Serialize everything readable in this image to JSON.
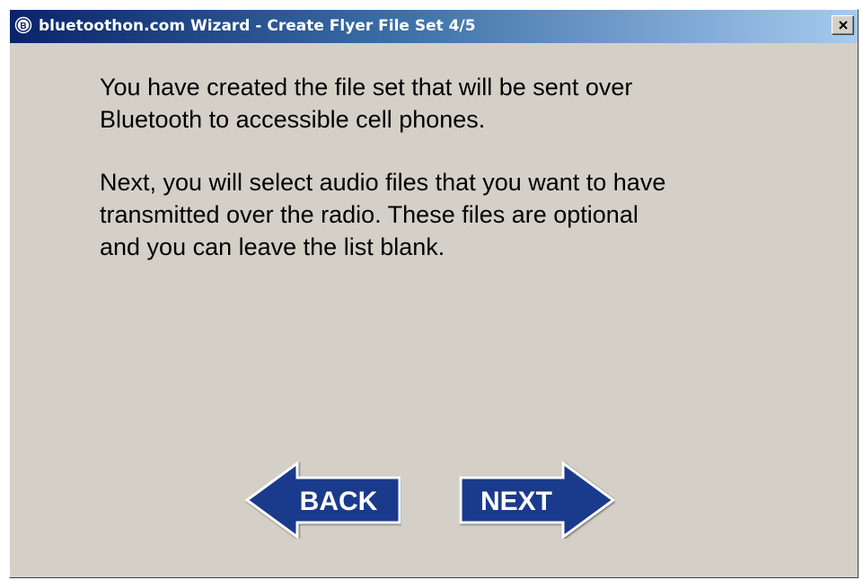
{
  "window": {
    "title": "bluetoothon.com Wizard - Create Flyer File Set 4/5",
    "close_symbol": "×"
  },
  "content": {
    "paragraph1": "You have created the file set that will be sent over\nBluetooth to accessible cell phones.",
    "paragraph2": "Next, you will select audio files that you want to have\ntransmitted over the radio.  These files are optional\nand you can leave the list blank."
  },
  "nav": {
    "back_label": "BACK",
    "next_label": "NEXT"
  },
  "colors": {
    "arrow_fill": "#1a3a8c",
    "window_bg": "#d4d0c8",
    "title_start": "#0a246a",
    "title_end": "#a6caf0"
  },
  "icons": {
    "app": "bluetooth-b-icon",
    "close": "close-icon"
  }
}
